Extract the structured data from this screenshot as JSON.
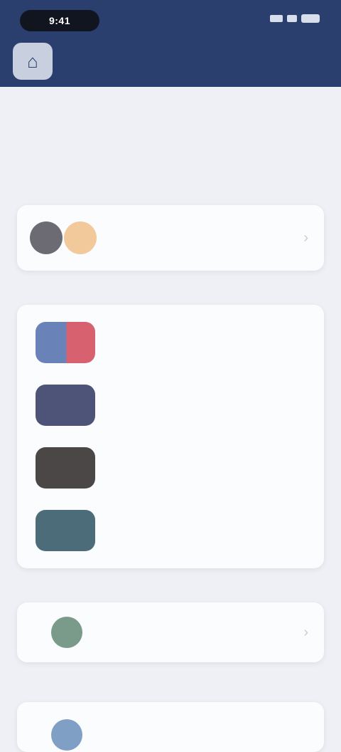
{
  "status_bar": {
    "time": "9:41"
  },
  "header": {
    "title": "",
    "home_icon": "home-icon"
  },
  "page": {
    "title": "",
    "description": ""
  },
  "sections": [
    {
      "label": "",
      "rows": [
        {
          "title": "",
          "subtitle": ""
        }
      ]
    },
    {
      "label": "",
      "rows": [
        {
          "title": "",
          "subtitle": "",
          "thumb_color": "#6983b8"
        },
        {
          "title": "",
          "subtitle": "",
          "thumb_color": "#4e5478"
        },
        {
          "title": "",
          "subtitle": "",
          "thumb_color": "#4a4746"
        },
        {
          "title": "",
          "subtitle": "",
          "thumb_color": "#4d6c7a"
        }
      ]
    },
    {
      "label": "",
      "rows": [
        {
          "title": "",
          "icon_color": "#7a9a8a"
        }
      ]
    },
    {
      "label": "",
      "rows": [
        {
          "title": "",
          "icon_color": "#7fa0c4"
        }
      ]
    }
  ],
  "colors": {
    "header_bg": "#2b3f6e",
    "page_bg": "#eef0f5",
    "card_bg": "#fbfcfe"
  }
}
